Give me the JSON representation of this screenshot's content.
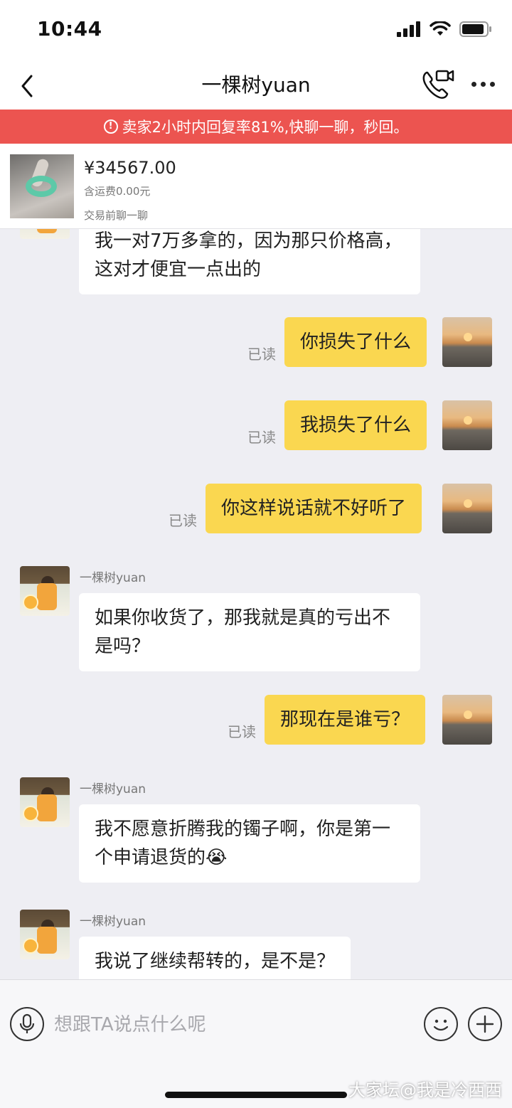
{
  "status_bar": {
    "time": "10:44",
    "icons": [
      "signal-icon",
      "wifi-icon",
      "battery-icon"
    ]
  },
  "header": {
    "title": "一棵树yuan",
    "icons": [
      "back-icon",
      "video-call-icon",
      "more-icon"
    ]
  },
  "notice": {
    "icon": "alert-icon",
    "text": "卖家2小时内回复率81%,快聊一聊，秒回。",
    "color": "#ec5450"
  },
  "product": {
    "price": "¥34567.00",
    "shipping": "含运费0.00元",
    "subtitle": "交易前聊一聊"
  },
  "messages": [
    {
      "side": "in",
      "text": "我一对7万多拿的，因为那只价格高，这对才便宜一点出的"
    },
    {
      "side": "out",
      "text": "你损失了什么",
      "status": "已读"
    },
    {
      "side": "out",
      "text": "我损失了什么",
      "status": "已读"
    },
    {
      "side": "out",
      "text": "你这样说话就不好听了",
      "status": "已读"
    },
    {
      "side": "in",
      "sender": "一棵树yuan",
      "text": "如果你收货了，那我就是真的亏出不是吗？"
    },
    {
      "side": "out",
      "text": "那现在是谁亏？",
      "status": "已读"
    },
    {
      "side": "in",
      "sender": "一棵树yuan",
      "text": "我不愿意折腾我的镯子啊，你是第一个申请退货的😭"
    },
    {
      "side": "in",
      "sender": "一棵树yuan",
      "text": "我说了继续帮转的，是不是？"
    }
  ],
  "input": {
    "placeholder": "想跟TA说点什么呢",
    "icons": [
      "mic-icon",
      "emoji-icon",
      "plus-icon"
    ]
  },
  "watermark": "大家坛@我是冷西西",
  "colors": {
    "bubble_out": "#fad750",
    "bubble_in": "#ffffff",
    "chat_background": "#eeeef3"
  }
}
